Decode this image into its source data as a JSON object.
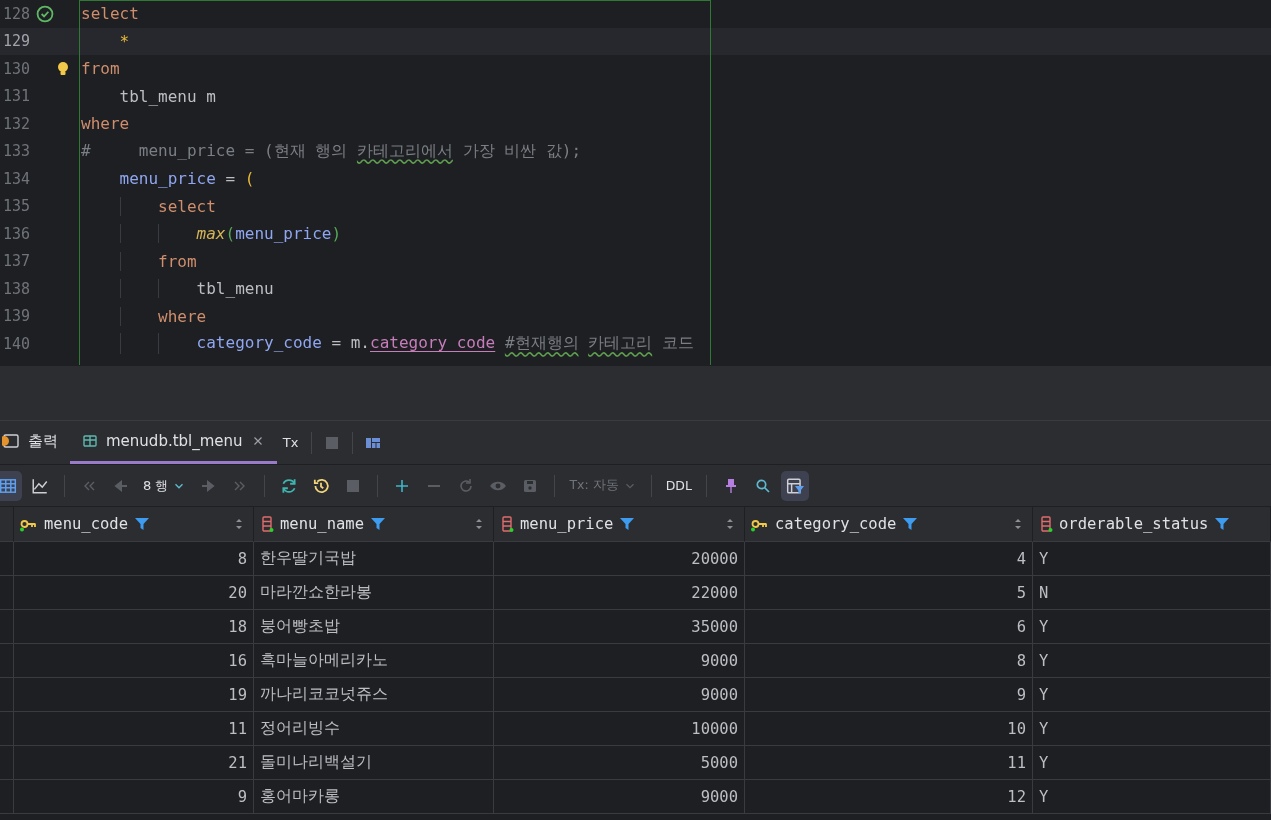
{
  "editor": {
    "lines": [
      {
        "number": "128",
        "current": false,
        "executed": true,
        "bulb": false,
        "tokens": [
          {
            "text": "select",
            "kind": "keyword"
          }
        ]
      },
      {
        "number": "129",
        "current": true,
        "executed": false,
        "bulb": false,
        "tokens": [
          {
            "text": "    *",
            "kind": "star"
          }
        ]
      },
      {
        "number": "130",
        "current": false,
        "executed": false,
        "bulb": true,
        "tokens": [
          {
            "text": "from",
            "kind": "keyword"
          }
        ]
      },
      {
        "number": "131",
        "current": false,
        "executed": false,
        "bulb": false,
        "tokens": [
          {
            "text": "    tbl_menu m",
            "kind": "plain"
          }
        ]
      },
      {
        "number": "132",
        "current": false,
        "executed": false,
        "bulb": false,
        "tokens": [
          {
            "text": "where",
            "kind": "keyword"
          }
        ]
      },
      {
        "number": "133",
        "current": false,
        "executed": false,
        "bulb": false,
        "tokens": [
          {
            "text": "#     menu_price = (현재 행의",
            "kind": "comment"
          },
          {
            "text": " 카테고리에서",
            "kind": "comment",
            "typo": true
          },
          {
            "text": " 가장 비싼 값);",
            "kind": "comment"
          }
        ]
      },
      {
        "number": "134",
        "current": false,
        "executed": false,
        "bulb": false,
        "tokens": [
          {
            "text": "    menu_price",
            "kind": "ident"
          },
          {
            "text": " = ",
            "kind": "plain"
          },
          {
            "text": "(",
            "kind": "paren"
          }
        ]
      },
      {
        "number": "135",
        "current": false,
        "executed": false,
        "bulb": false,
        "tokens": [
          {
            "text": "        select",
            "kind": "keyword"
          }
        ]
      },
      {
        "number": "136",
        "current": false,
        "executed": false,
        "bulb": false,
        "tokens": [
          {
            "text": "            max",
            "kind": "func"
          },
          {
            "text": "(",
            "kind": "inner_paren"
          },
          {
            "text": "menu_price",
            "kind": "ident"
          },
          {
            "text": ")",
            "kind": "inner_paren"
          }
        ]
      },
      {
        "number": "137",
        "current": false,
        "executed": false,
        "bulb": false,
        "tokens": [
          {
            "text": "        from",
            "kind": "keyword"
          }
        ]
      },
      {
        "number": "138",
        "current": false,
        "executed": false,
        "bulb": false,
        "tokens": [
          {
            "text": "            tbl_menu",
            "kind": "plain"
          }
        ]
      },
      {
        "number": "139",
        "current": false,
        "executed": false,
        "bulb": false,
        "tokens": [
          {
            "text": "        where",
            "kind": "keyword"
          }
        ]
      },
      {
        "number": "140",
        "current": false,
        "executed": false,
        "bulb": false,
        "tokens": [
          {
            "text": "            category_code",
            "kind": "ident"
          },
          {
            "text": " = m.",
            "kind": "plain"
          },
          {
            "text": "category_code",
            "kind": "field"
          },
          {
            "text": " #현재행의",
            "kind": "comment",
            "typo": true
          },
          {
            "text": " 카테고리",
            "kind": "comment",
            "typo": true
          },
          {
            "text": " 코드",
            "kind": "comment"
          }
        ]
      }
    ]
  },
  "tabs": [
    {
      "label": "출력",
      "selected": false,
      "closable": false,
      "kind": "output"
    },
    {
      "label": "menudb.tbl_menu",
      "selected": true,
      "closable": true,
      "kind": "table"
    }
  ],
  "tab_actions": {
    "tx": "Tx"
  },
  "toolbar": {
    "grid_view_selected": true,
    "rows_label": "8 행",
    "tx_mode": "Tx: 자동",
    "ddl": "DDL",
    "filter_selected": true
  },
  "table": {
    "columns": [
      {
        "name": "menu_code",
        "kind": "key",
        "numeric": true,
        "sortable": true
      },
      {
        "name": "menu_name",
        "kind": "column",
        "numeric": false,
        "sortable": true
      },
      {
        "name": "menu_price",
        "kind": "column",
        "numeric": true,
        "sortable": true
      },
      {
        "name": "category_code",
        "kind": "key",
        "numeric": true,
        "sortable": true
      },
      {
        "name": "orderable_status",
        "kind": "column",
        "numeric": false,
        "sortable": false
      }
    ],
    "rows": [
      [
        "8",
        "한우딸기국밥",
        "20000",
        "4",
        "Y"
      ],
      [
        "20",
        "마라깐쇼한라봉",
        "22000",
        "5",
        "N"
      ],
      [
        "18",
        "붕어빵초밥",
        "35000",
        "6",
        "Y"
      ],
      [
        "16",
        "흑마늘아메리카노",
        "9000",
        "8",
        "Y"
      ],
      [
        "19",
        "까나리코코넛쥬스",
        "9000",
        "9",
        "Y"
      ],
      [
        "11",
        "정어리빙수",
        "10000",
        "10",
        "Y"
      ],
      [
        "21",
        "돌미나리백설기",
        "5000",
        "11",
        "Y"
      ],
      [
        "9",
        "홍어마카롱",
        "9000",
        "12",
        "Y"
      ]
    ]
  }
}
